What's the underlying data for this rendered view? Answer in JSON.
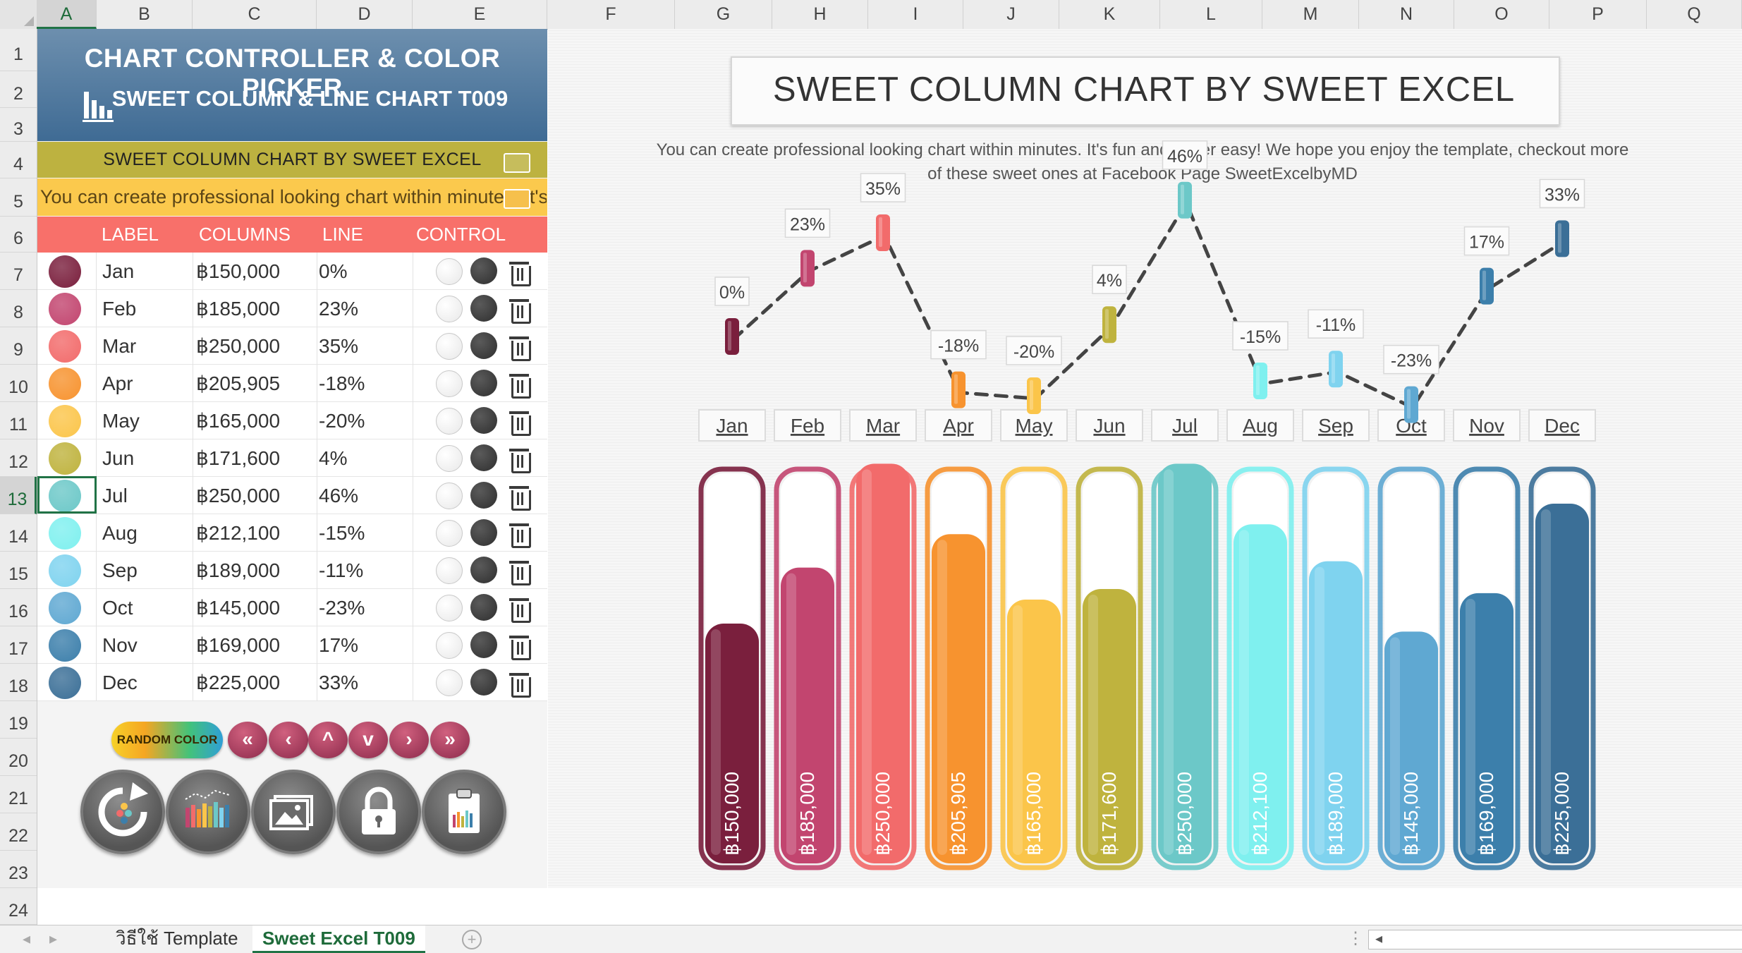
{
  "columns": [
    "A",
    "B",
    "C",
    "D",
    "E",
    "F",
    "G",
    "H",
    "I",
    "J",
    "K",
    "L",
    "M",
    "N",
    "O",
    "P",
    "Q"
  ],
  "rows": [
    "1",
    "2",
    "3",
    "4",
    "5",
    "6",
    "7",
    "8",
    "9",
    "10",
    "11",
    "12",
    "13",
    "14",
    "15",
    "16",
    "17",
    "18",
    "19",
    "20",
    "21",
    "22",
    "23",
    "24"
  ],
  "panel": {
    "title": "CHART CONTROLLER & COLOR PICKER",
    "subtitle": "SWEET COLUMN & LINE CHART T009",
    "chart_title_cell": "SWEET COLUMN CHART BY SWEET EXCEL",
    "description_cell": "You can create professional looking chart within minutes. It's fun and super easy!",
    "headers": {
      "label": "LABEL",
      "columns": "COLUMNS",
      "line": "LINE",
      "control": "CONTROL"
    },
    "random_color_label": "RANDOM COLOR",
    "nav_buttons": [
      "«",
      "‹",
      "^",
      "v",
      "›",
      "»"
    ]
  },
  "table": [
    {
      "label": "Jan",
      "column": "฿150,000",
      "line": "0%",
      "color": "#7a1f3d"
    },
    {
      "label": "Feb",
      "column": "฿185,000",
      "line": "23%",
      "color": "#c2456f"
    },
    {
      "label": "Mar",
      "column": "฿250,000",
      "line": "35%",
      "color": "#f26b6b"
    },
    {
      "label": "Apr",
      "column": "฿205,905",
      "line": "-18%",
      "color": "#f7932f"
    },
    {
      "label": "May",
      "column": "฿165,000",
      "line": "-20%",
      "color": "#fbc54a"
    },
    {
      "label": "Jun",
      "column": "฿171,600",
      "line": "4%",
      "color": "#bfb33e"
    },
    {
      "label": "Jul",
      "column": "฿250,000",
      "line": "46%",
      "color": "#6cc8c8"
    },
    {
      "label": "Aug",
      "column": "฿212,100",
      "line": "-15%",
      "color": "#7ff0ef"
    },
    {
      "label": "Sep",
      "column": "฿189,000",
      "line": "-11%",
      "color": "#7fd3ef"
    },
    {
      "label": "Oct",
      "column": "฿145,000",
      "line": "-23%",
      "color": "#5fa8d2"
    },
    {
      "label": "Nov",
      "column": "฿169,000",
      "line": "17%",
      "color": "#3c7fab"
    },
    {
      "label": "Dec",
      "column": "฿225,000",
      "line": "33%",
      "color": "#3b6f97"
    }
  ],
  "chart": {
    "title": "SWEET COLUMN CHART BY SWEET EXCEL",
    "subtitle_line1": "You can create professional looking chart within minutes. It's fun and super easy! We hope you enjoy the template, checkout more",
    "subtitle_line2": "of these sweet ones at Facebook Page SweetExcelbyMD"
  },
  "chart_data": {
    "type": "bar",
    "categories": [
      "Jan",
      "Feb",
      "Mar",
      "Apr",
      "May",
      "Jun",
      "Jul",
      "Aug",
      "Sep",
      "Oct",
      "Nov",
      "Dec"
    ],
    "series": [
      {
        "values": [
          150000,
          185000,
          250000,
          205905,
          165000,
          171600,
          250000,
          212100,
          189000,
          145000,
          169000,
          225000
        ]
      },
      {
        "values": [
          0,
          23,
          35,
          -18,
          -20,
          4,
          46,
          -15,
          -11,
          -23,
          17,
          33
        ]
      }
    ],
    "value_labels": [
      "฿150,000",
      "฿185,000",
      "฿250,000",
      "฿205,905",
      "฿165,000",
      "฿171,600",
      "฿250,000",
      "฿212,100",
      "฿189,000",
      "฿145,000",
      "฿169,000",
      "฿225,000"
    ],
    "line_labels": [
      "0%",
      "23%",
      "35%",
      "-18%",
      "-20%",
      "4%",
      "46%",
      "-15%",
      "-11%",
      "-23%",
      "17%",
      "33%"
    ],
    "ylim": [
      0,
      300000
    ],
    "line_ylim": [
      -30,
      50
    ]
  },
  "tabs": [
    "วิธีใช้ Template",
    "Sweet Excel T009"
  ],
  "selected_cell": {
    "column": "A",
    "row": "13"
  }
}
